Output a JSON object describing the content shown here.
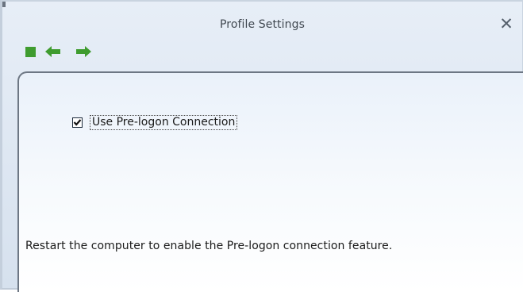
{
  "window": {
    "title": "Profile Settings",
    "close_glyph": "✕",
    "close_icon": "close-icon"
  },
  "toolbar": {
    "buttons": [
      {
        "icon": "stop-square-icon",
        "color": "#3f9c2f"
      },
      {
        "icon": "arrow-left-icon",
        "color": "#3f9c2f"
      },
      {
        "icon": "arrow-right-icon",
        "color": "#3f9c2f"
      }
    ]
  },
  "panel": {
    "checkbox_label": "Use Pre-logon Connection",
    "checkbox_checked": true,
    "info_text": "Restart the computer to enable the Pre-logon connection feature."
  },
  "colors": {
    "accent_green": "#3f9c2f",
    "window_bg": "#dfe7f2",
    "panel_border": "#6d7784"
  }
}
